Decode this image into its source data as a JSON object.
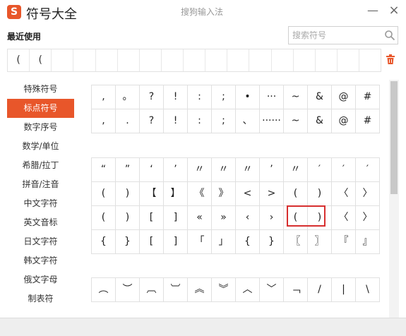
{
  "window": {
    "title": "符号大全",
    "logo_text": "S",
    "ime_name": "搜狗输入法",
    "minimize": "—",
    "close": "×"
  },
  "recent": {
    "label": "最近使用",
    "symbols": [
      "(",
      "(",
      "",
      "",
      "",
      "",
      "",
      "",
      "",
      "",
      "",
      "",
      "",
      "",
      "",
      "",
      ""
    ]
  },
  "search": {
    "placeholder": "搜索符号",
    "value": ""
  },
  "icons": {
    "search": "search-icon",
    "trash": "trash-icon",
    "accent": "#e8562a",
    "highlight": "#d72f2f"
  },
  "categories": [
    {
      "label": "特殊符号",
      "active": false
    },
    {
      "label": "标点符号",
      "active": true
    },
    {
      "label": "数字序号",
      "active": false
    },
    {
      "label": "数学/单位",
      "active": false
    },
    {
      "label": "希腊/拉丁",
      "active": false
    },
    {
      "label": "拼音/注音",
      "active": false
    },
    {
      "label": "中文字符",
      "active": false
    },
    {
      "label": "英文音标",
      "active": false
    },
    {
      "label": "日文字符",
      "active": false
    },
    {
      "label": "韩文字符",
      "active": false
    },
    {
      "label": "俄文字母",
      "active": false
    },
    {
      "label": "制表符",
      "active": false
    }
  ],
  "symbol_grids": [
    {
      "rows": [
        [
          ",",
          "。",
          "?",
          "!",
          ":",
          ";",
          "•",
          "···",
          "~",
          "&",
          "@",
          "#"
        ],
        [
          ",",
          ".",
          "?",
          "!",
          ":",
          ";",
          "、",
          "······",
          "~",
          "&",
          "@",
          "#"
        ]
      ]
    },
    {
      "rows": [
        [
          "“",
          "”",
          "‘",
          "’",
          "〃",
          "〃",
          "〃",
          "’",
          "〃",
          "′",
          "′",
          "′"
        ],
        [
          "(",
          ")",
          "【",
          "】",
          "《",
          "》",
          "<",
          ">",
          "(",
          ")",
          "〈",
          "〉"
        ],
        [
          "(",
          ")",
          "[",
          "]",
          "«",
          "»",
          "‹",
          "›",
          "(",
          ")",
          "〈",
          "〉"
        ],
        [
          "{",
          "}",
          "[",
          "]",
          "「",
          "」",
          "{",
          "}",
          "〖",
          "〗",
          "『",
          "』"
        ]
      ]
    },
    {
      "rows": [
        [
          "︵",
          "︶",
          "︹",
          "︺",
          "︽",
          "︾",
          "︿",
          "﹀",
          "﹁",
          "/",
          "|",
          "\\"
        ]
      ]
    }
  ]
}
